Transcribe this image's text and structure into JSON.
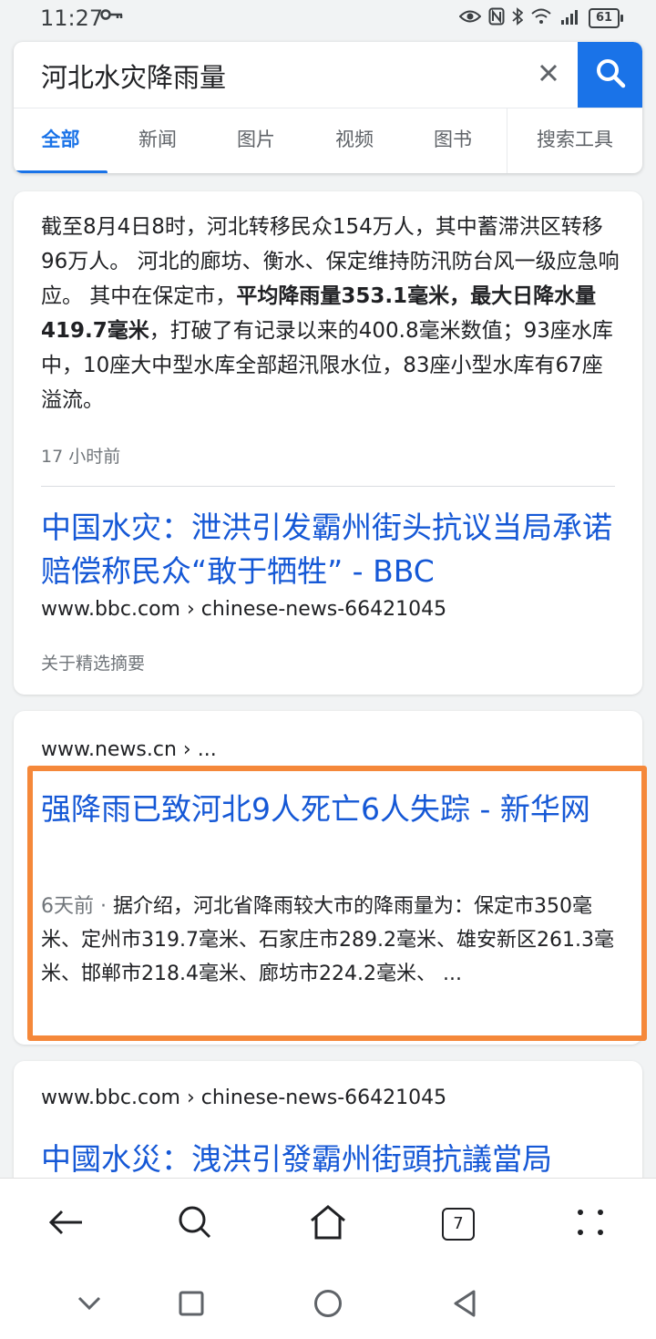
{
  "status": {
    "time": "11:27",
    "battery": "61"
  },
  "search": {
    "query": "河北水灾降雨量"
  },
  "tabs": [
    {
      "label": "全部"
    },
    {
      "label": "新闻"
    },
    {
      "label": "图片"
    },
    {
      "label": "视频"
    },
    {
      "label": "图书"
    },
    {
      "label": "搜索工具"
    }
  ],
  "featured": {
    "snippet_part1": "截至8月4日8时，河北转移民众154万人，其中蓄滞洪区转移96万人。 河北的廊坊、衡水、保定维持防汛防台风一级应急响应。 其中在保定市，",
    "snippet_bold": "平均降雨量353.1毫米，最大日降水量419.7毫米",
    "snippet_part2": "，打破了有记录以来的400.8毫米数值；93座水库中，10座大中型水库全部超汛限水位，83座小型水库有67座溢流。",
    "age": "17 小时前",
    "title": "中国水灾：泄洪引发霸州街头抗议当局承诺赔偿称民众“敢于牺牲” - BBC",
    "url": "www.bbc.com › chinese-news-66421045",
    "about": "关于精选摘要"
  },
  "result2": {
    "url": "www.news.cn › ...",
    "title": "强降雨已致河北9人死亡6人失踪 - 新华网",
    "age": "6天前",
    "separator": " · ",
    "snippet": "据介绍，河北省降雨较大市的降雨量为：保定市350毫米、定州市319.7毫米、石家庄市289.2毫米、雄安新区261.3毫米、邯郸市218.4毫米、廊坊市224.2毫米、 ..."
  },
  "result3": {
    "url": "www.bbc.com › chinese-news-66421045",
    "title": "中國水災：洩洪引發霸州街頭抗議當局"
  },
  "browser": {
    "tab_count": "7"
  },
  "colors": {
    "accent": "#1a73e8",
    "highlight": "#f5883a",
    "link": "#1558d6"
  }
}
